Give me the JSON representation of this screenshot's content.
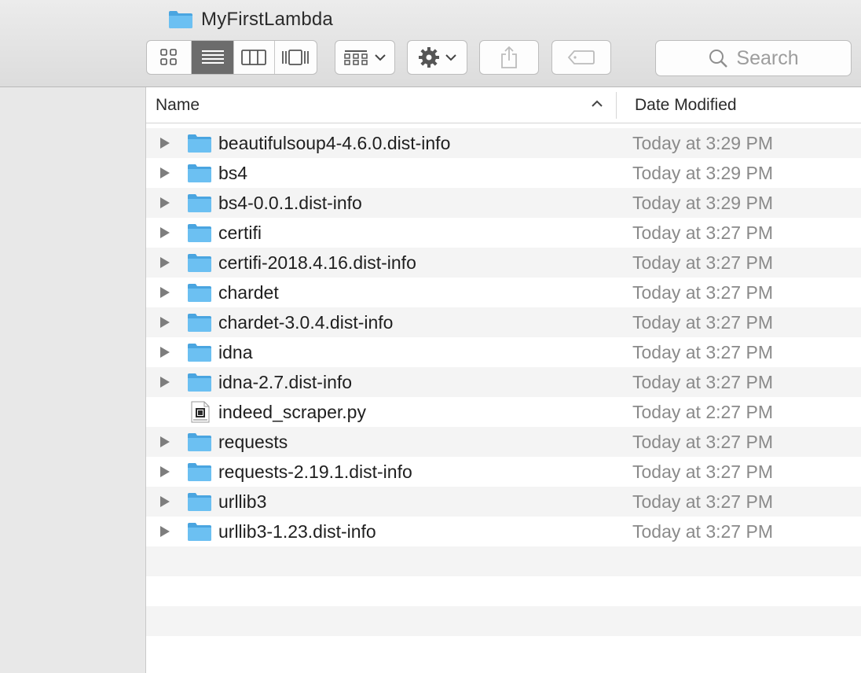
{
  "window": {
    "title": "MyFirstLambda",
    "title_icon": "folder-icon"
  },
  "toolbar": {
    "view_modes": [
      {
        "name": "icon-view",
        "icon": "grid-icon",
        "active": false
      },
      {
        "name": "list-view",
        "icon": "list-icon",
        "active": true
      },
      {
        "name": "column-view",
        "icon": "columns-icon",
        "active": false
      },
      {
        "name": "cover-flow-view",
        "icon": "cover-flow-icon",
        "active": false
      }
    ],
    "arrange_icon": "arrange-grid-icon",
    "action_icon": "gear-icon",
    "share_icon": "share-icon",
    "tag_icon": "tag-icon",
    "search_placeholder": "Search"
  },
  "list": {
    "columns": {
      "name": "Name",
      "date_modified": "Date Modified",
      "sort": "ascending"
    },
    "items": [
      {
        "name": "beautifulsoup4-4.6.0.dist-info",
        "date": "Today at 3:29 PM",
        "kind": "folder"
      },
      {
        "name": "bs4",
        "date": "Today at 3:29 PM",
        "kind": "folder"
      },
      {
        "name": "bs4-0.0.1.dist-info",
        "date": "Today at 3:29 PM",
        "kind": "folder"
      },
      {
        "name": "certifi",
        "date": "Today at 3:27 PM",
        "kind": "folder"
      },
      {
        "name": "certifi-2018.4.16.dist-info",
        "date": "Today at 3:27 PM",
        "kind": "folder"
      },
      {
        "name": "chardet",
        "date": "Today at 3:27 PM",
        "kind": "folder"
      },
      {
        "name": "chardet-3.0.4.dist-info",
        "date": "Today at 3:27 PM",
        "kind": "folder"
      },
      {
        "name": "idna",
        "date": "Today at 3:27 PM",
        "kind": "folder"
      },
      {
        "name": "idna-2.7.dist-info",
        "date": "Today at 3:27 PM",
        "kind": "folder"
      },
      {
        "name": "indeed_scraper.py",
        "date": "Today at 2:27 PM",
        "kind": "python-file"
      },
      {
        "name": "requests",
        "date": "Today at 3:27 PM",
        "kind": "folder"
      },
      {
        "name": "requests-2.19.1.dist-info",
        "date": "Today at 3:27 PM",
        "kind": "folder"
      },
      {
        "name": "urllib3",
        "date": "Today at 3:27 PM",
        "kind": "folder"
      },
      {
        "name": "urllib3-1.23.dist-info",
        "date": "Today at 3:27 PM",
        "kind": "folder"
      }
    ]
  },
  "colors": {
    "folder": "#6cc0f2",
    "folder_dark": "#4aa5e0",
    "active_segment": "#6c6c6c",
    "date_text": "#8a8a8a"
  }
}
